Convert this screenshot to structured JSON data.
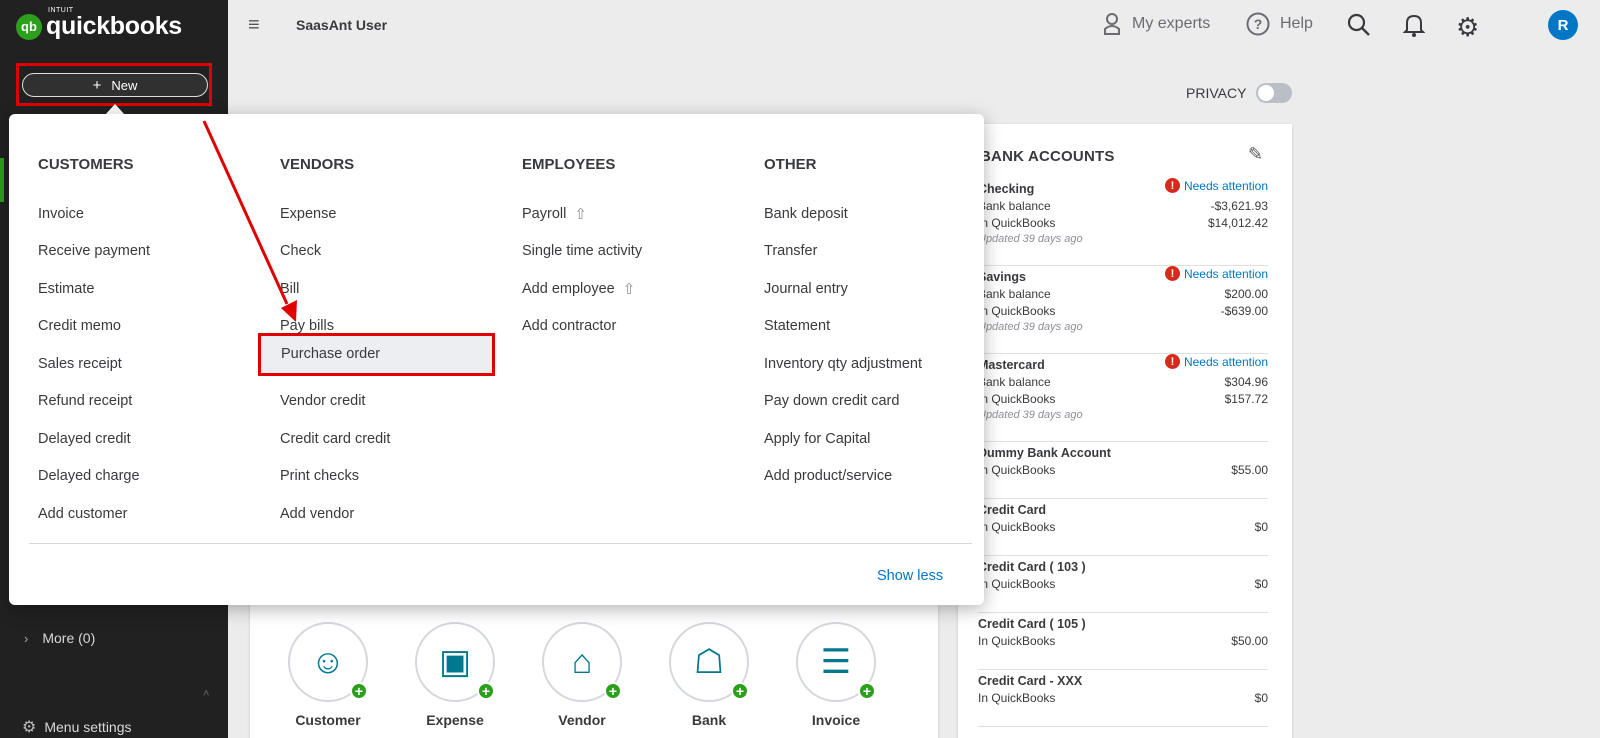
{
  "brand": {
    "intuit": "INTUIT",
    "name": "quickbooks",
    "mark": "qb"
  },
  "sidebar": {
    "new_button": "New",
    "new_plus": "+",
    "more_label": "More (0)",
    "menu_settings": "Menu settings"
  },
  "header": {
    "company": "SaasAnt User",
    "my_experts": "My experts",
    "help": "Help",
    "avatar_initial": "R",
    "privacy_label": "PRIVACY"
  },
  "new_menu": {
    "columns": [
      {
        "title": "CUSTOMERS",
        "items": [
          {
            "label": "Invoice"
          },
          {
            "label": "Receive payment"
          },
          {
            "label": "Estimate"
          },
          {
            "label": "Credit memo"
          },
          {
            "label": "Sales receipt"
          },
          {
            "label": "Refund receipt"
          },
          {
            "label": "Delayed credit"
          },
          {
            "label": "Delayed charge"
          },
          {
            "label": "Add customer"
          }
        ]
      },
      {
        "title": "VENDORS",
        "items": [
          {
            "label": "Expense"
          },
          {
            "label": "Check"
          },
          {
            "label": "Bill"
          },
          {
            "label": "Pay bills"
          },
          {
            "label": "Purchase order"
          },
          {
            "label": "Vendor credit"
          },
          {
            "label": "Credit card credit"
          },
          {
            "label": "Print checks"
          },
          {
            "label": "Add vendor"
          }
        ]
      },
      {
        "title": "EMPLOYEES",
        "items": [
          {
            "label": "Payroll",
            "upgrade": true
          },
          {
            "label": "Single time activity"
          },
          {
            "label": "Add employee",
            "upgrade": true
          },
          {
            "label": "Add contractor"
          }
        ]
      },
      {
        "title": "OTHER",
        "items": [
          {
            "label": "Bank deposit"
          },
          {
            "label": "Transfer"
          },
          {
            "label": "Journal entry"
          },
          {
            "label": "Statement"
          },
          {
            "label": "Inventory qty adjustment"
          },
          {
            "label": "Pay down credit card"
          },
          {
            "label": "Apply for Capital"
          },
          {
            "label": "Add product/service"
          }
        ]
      }
    ],
    "show_less": "Show less",
    "upgrade_icon": "upgrade-arrow-icon"
  },
  "bank_accounts": {
    "title": "BANK ACCOUNTS",
    "needs_attention": "Needs attention",
    "accounts": [
      {
        "name": "Checking",
        "bank_label": "Bank balance",
        "bank_value": "-$3,621.93",
        "qb_label": "In QuickBooks",
        "qb_value": "$14,012.42",
        "updated": "Updated 39 days ago",
        "attention": true
      },
      {
        "name": "Savings",
        "bank_label": "Bank balance",
        "bank_value": "$200.00",
        "qb_label": "In QuickBooks",
        "qb_value": "-$639.00",
        "updated": "Updated 39 days ago",
        "attention": true
      },
      {
        "name": "Mastercard",
        "bank_label": "Bank balance",
        "bank_value": "$304.96",
        "qb_label": "In QuickBooks",
        "qb_value": "$157.72",
        "updated": "Updated 39 days ago",
        "attention": true
      },
      {
        "name": "Dummy Bank Account",
        "qb_label": "In QuickBooks",
        "qb_value": "$55.00"
      },
      {
        "name": "Credit Card",
        "qb_label": "In QuickBooks",
        "qb_value": "$0"
      },
      {
        "name": "Credit Card ( 103 )",
        "qb_label": "In QuickBooks",
        "qb_value": "$0"
      },
      {
        "name": "Credit Card ( 105 )",
        "qb_label": "In QuickBooks",
        "qb_value": "$50.00"
      },
      {
        "name": "Credit Card - XXX",
        "qb_label": "In QuickBooks",
        "qb_value": "$0"
      }
    ]
  },
  "shortcuts": [
    {
      "label": "Customer",
      "icon": "person-icon"
    },
    {
      "label": "Expense",
      "icon": "wallet-icon"
    },
    {
      "label": "Vendor",
      "icon": "cart-icon"
    },
    {
      "label": "Bank",
      "icon": "bank-icon"
    },
    {
      "label": "Invoice",
      "icon": "invoice-icon"
    }
  ],
  "colors": {
    "sidebar": "#212121",
    "brand_green": "#2ca01c",
    "link_blue": "#0077c5",
    "highlight_red": "#e00000"
  }
}
